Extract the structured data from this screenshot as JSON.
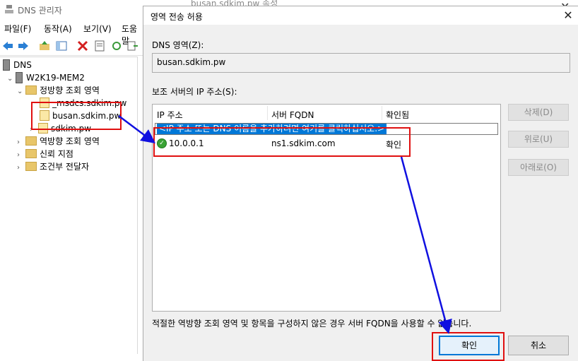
{
  "background_window": {
    "title": "DNS 관리자",
    "other_title": "busan.sdkim.pw 속성",
    "menu": [
      "파일(F)",
      "동작(A)",
      "보기(V)",
      "도움말"
    ],
    "tree": {
      "root": "DNS",
      "server": "W2K19-MEM2",
      "forward_zones": "정방향 조회 영역",
      "zones": [
        "_msdcs.sdkim.pw",
        "busan.sdkim.pw",
        "sdkim.pw"
      ],
      "reverse_zones": "역방향 조회 영역",
      "trust_points": "신뢰 지점",
      "conditional_forwarders": "조건부 전달자"
    }
  },
  "dialog": {
    "title": "영역 전송 허용",
    "zone_label": "DNS 영역(Z):",
    "zone_value": "busan.sdkim.pw",
    "secondary_label": "보조 서버의 IP 주소(S):",
    "columns": [
      "IP 주소",
      "서버 FQDN",
      "확인됨"
    ],
    "add_row_placeholder": "<IP 주소 또는 DNS 이름을 추가하려면 여기를 클릭하십시오.>",
    "rows": [
      {
        "ip": "10.0.0.1",
        "fqdn": "ns1.sdkim.com",
        "validated": "확인"
      }
    ],
    "buttons": {
      "delete": "삭제(D)",
      "up": "위로(U)",
      "down": "아래로(O)",
      "ok": "확인",
      "cancel": "취소"
    },
    "note": "적절한 역방향 조회 영역 및 항목을 구성하지 않은 경우 서버 FQDN을 사용할 수 없습니다."
  },
  "annotation_colors": {
    "highlight": "#e01010",
    "arrow": "#1010e0"
  }
}
